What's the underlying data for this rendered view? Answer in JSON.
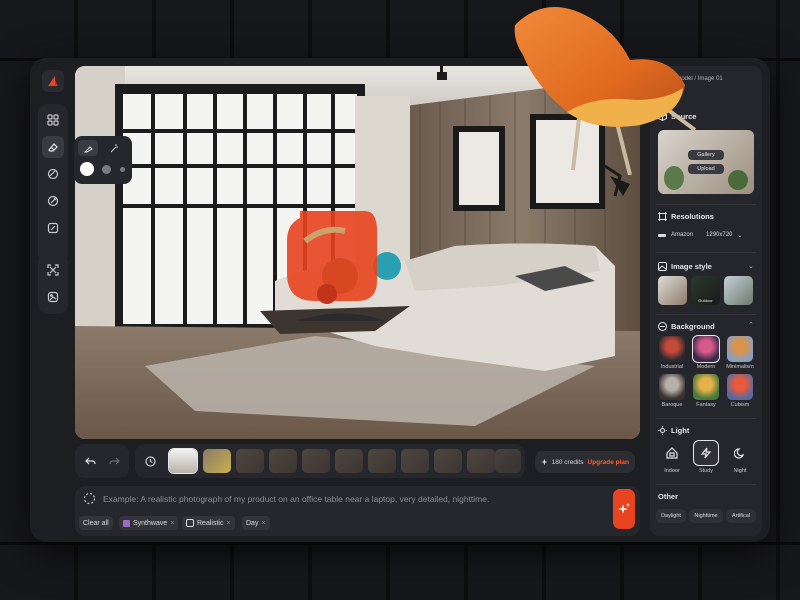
{
  "toolbar": {
    "items": [
      {
        "icon": "grid-icon"
      },
      {
        "icon": "eraser-icon",
        "active": true
      },
      {
        "icon": "palette-icon"
      },
      {
        "icon": "pen-icon"
      },
      {
        "icon": "crop-icon"
      }
    ],
    "bottom_items": [
      {
        "icon": "expand-icon"
      },
      {
        "icon": "image-edit-icon"
      }
    ]
  },
  "canvas": {
    "description": "living room render"
  },
  "bottom_bar": {
    "credits": "180 credits",
    "upgrade": "Upgrade plan",
    "thumbnail_count": 11
  },
  "prompt": {
    "placeholder": "Example: A realistic photograph of my product on an office table near a laptop, very detailed, nighttime.",
    "clear_all": "Clear all",
    "tags": [
      "Synthwave",
      "Realistic",
      "Day"
    ]
  },
  "panel": {
    "breadcrumb": "air model / Image 01",
    "source": {
      "title": "Source",
      "gallery": "Gallery",
      "upload": "Upload"
    },
    "resolutions": {
      "title": "Resolutions",
      "platform": "Amazon",
      "size": "1290x720"
    },
    "image_style": {
      "title": "Image style",
      "item_label": "Outdoor"
    },
    "background": {
      "title": "Background",
      "items": [
        {
          "label": "Industrial",
          "color": "#7a4a3a"
        },
        {
          "label": "Modern",
          "color": "#c44a5a"
        },
        {
          "label": "Minimalism",
          "color": "#8aa0c0"
        },
        {
          "label": "Baroque",
          "color": "#4a3a2a"
        },
        {
          "label": "Fantasy",
          "color": "#5a8a3a"
        },
        {
          "label": "Cubism",
          "color": "#b86a3a"
        }
      ]
    },
    "light": {
      "title": "Light",
      "items": [
        {
          "label": "Indoor",
          "icon": "house-icon"
        },
        {
          "label": "Study",
          "icon": "bolt-icon"
        },
        {
          "label": "Night",
          "icon": "moon-icon"
        }
      ]
    },
    "other": {
      "title": "Other",
      "items": [
        "Daylight",
        "Nighttime",
        "Artifical"
      ]
    }
  },
  "colors": {
    "accent": "#e8441f",
    "panel": "#25262b",
    "app_bg": "#1d1e22"
  }
}
